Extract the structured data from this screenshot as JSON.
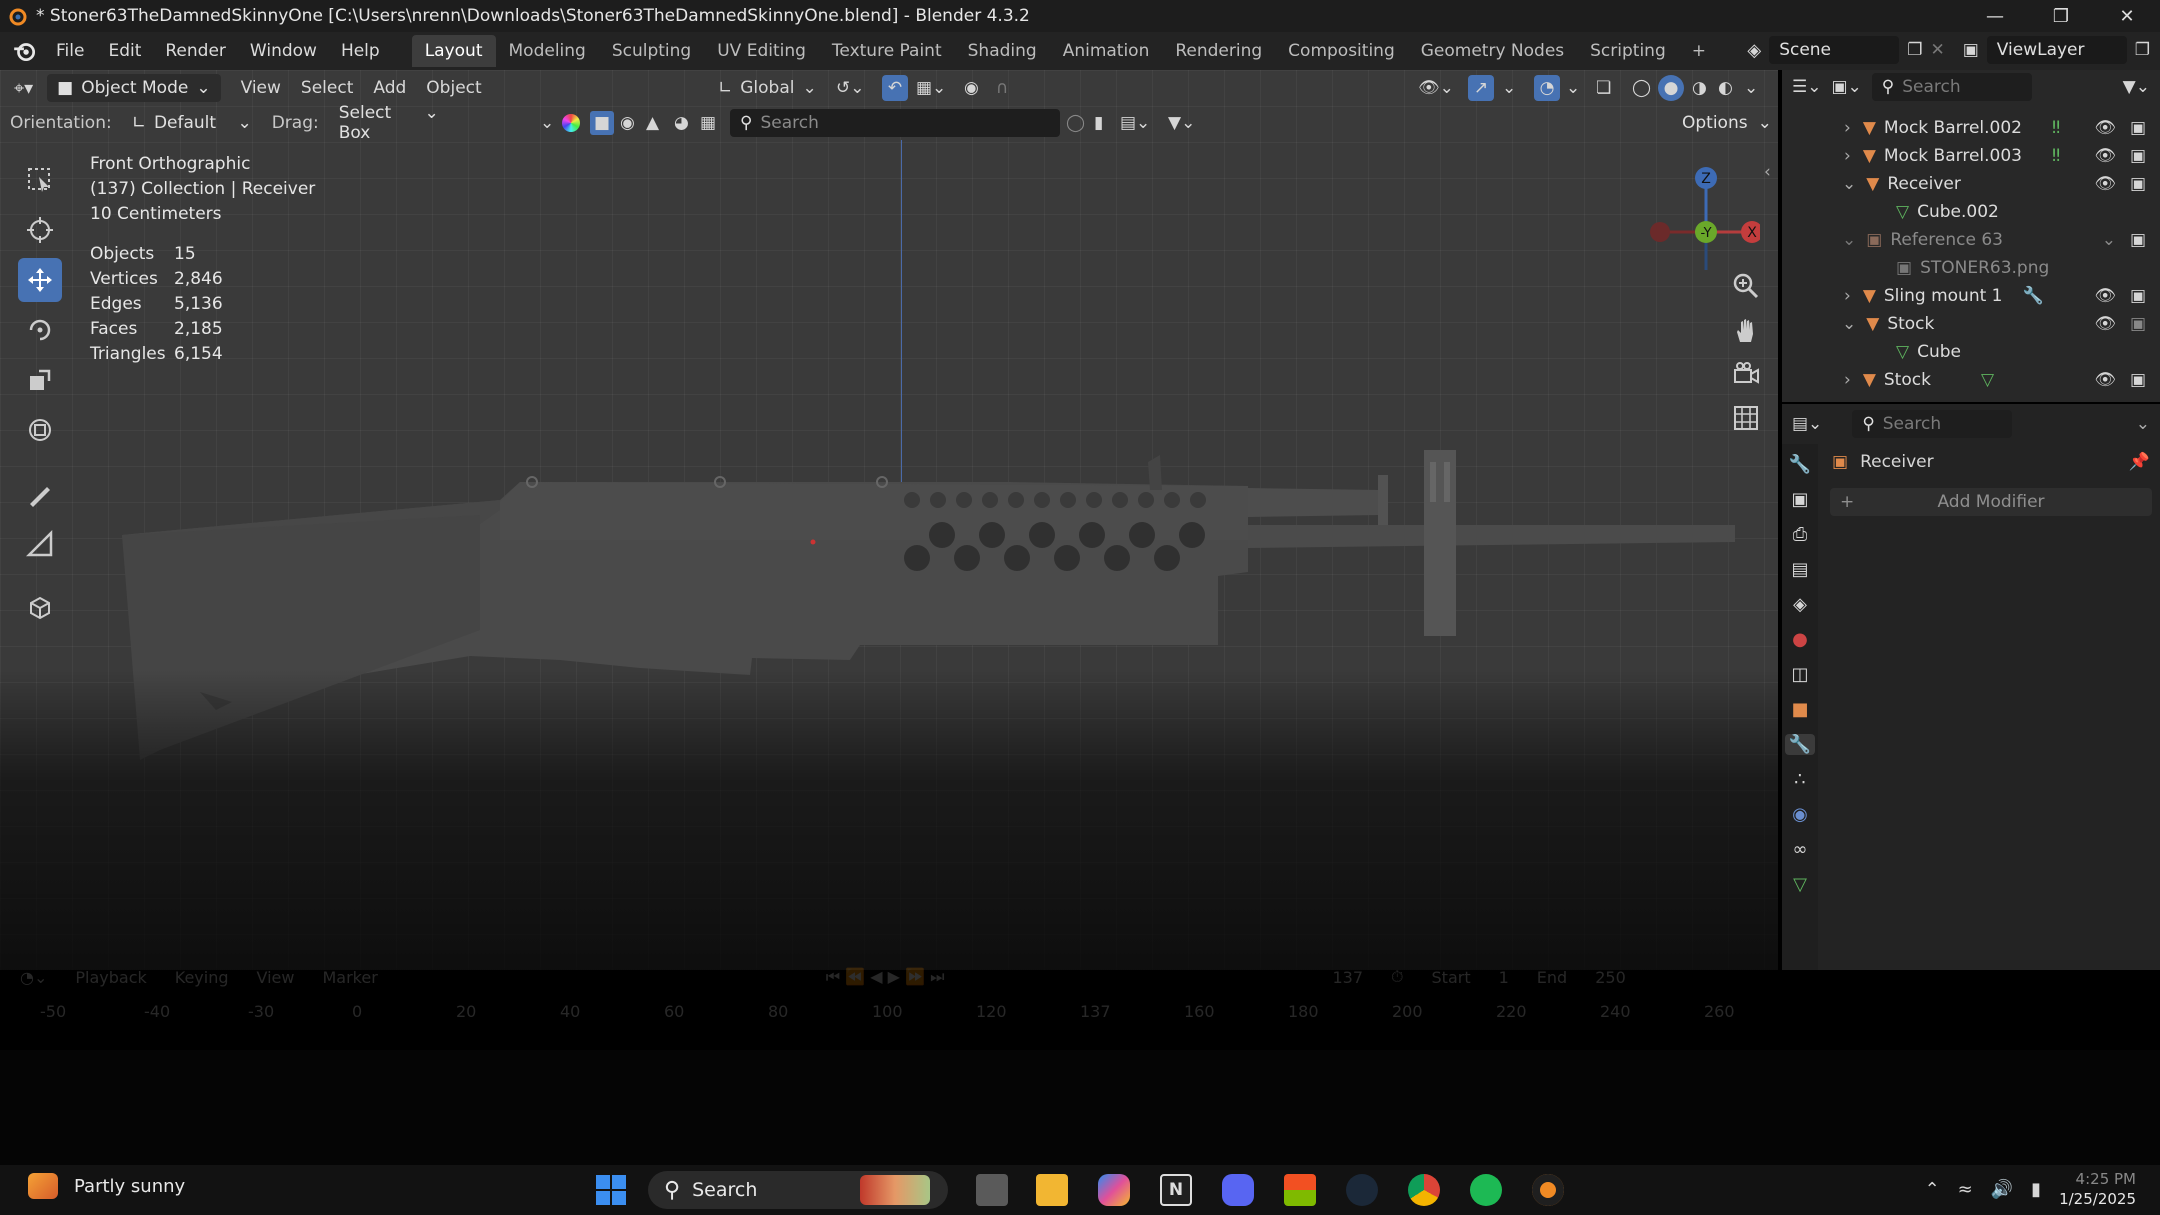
{
  "window": {
    "title": "* Stoner63TheDamnedSkinnyOne [C:\\Users\\nrenn\\Downloads\\Stoner63TheDamnedSkinnyOne.blend] - Blender 4.3.2"
  },
  "menu": {
    "items": [
      "File",
      "Edit",
      "Render",
      "Window",
      "Help"
    ]
  },
  "workspaces": {
    "tabs": [
      "Layout",
      "Modeling",
      "Sculpting",
      "UV Editing",
      "Texture Paint",
      "Shading",
      "Animation",
      "Rendering",
      "Compositing",
      "Geometry Nodes",
      "Scripting"
    ],
    "active": "Layout",
    "add": "+"
  },
  "scene": {
    "name": "Scene",
    "view_layer": "ViewLayer"
  },
  "viewport_header": {
    "mode": "Object Mode",
    "menus": [
      "View",
      "Select",
      "Add",
      "Object"
    ],
    "transform": "Global"
  },
  "tool_settings": {
    "orientation_label": "Orientation:",
    "orientation_value": "Default",
    "drag_label": "Drag:",
    "drag_value": "Select Box",
    "search_placeholder": "Search",
    "options": "Options"
  },
  "overlay": {
    "view_name": "Front Orthographic",
    "collection": "(137) Collection | Receiver",
    "scale": "10 Centimeters"
  },
  "stats": [
    {
      "label": "Objects",
      "value": "15"
    },
    {
      "label": "Vertices",
      "value": "2,846"
    },
    {
      "label": "Edges",
      "value": "5,136"
    },
    {
      "label": "Faces",
      "value": "2,185"
    },
    {
      "label": "Triangles",
      "value": "6,154"
    }
  ],
  "gizmo": {
    "z": "Z",
    "y": "-Y",
    "x": "X"
  },
  "outliner": {
    "search_placeholder": "Search",
    "rows": [
      {
        "label": "Mock Barrel.002",
        "indent": 0
      },
      {
        "label": "Mock Barrel.003",
        "indent": 0
      },
      {
        "label": "Receiver",
        "indent": 0
      },
      {
        "label": "Cube.002",
        "indent": 1
      },
      {
        "label": "Reference 63",
        "indent": 0
      },
      {
        "label": "STONER63.png",
        "indent": 1
      },
      {
        "label": "Sling mount 1",
        "indent": 0
      },
      {
        "label": "Stock",
        "indent": 0
      },
      {
        "label": "Cube",
        "indent": 1
      },
      {
        "label": "Stock",
        "indent": 0
      }
    ]
  },
  "properties": {
    "search_placeholder": "Search",
    "object_name": "Receiver",
    "add_modifier": "Add Modifier"
  },
  "timeline": {
    "menus": [
      "Playback",
      "Keying",
      "View",
      "Marker"
    ],
    "current_frame": "137",
    "start_label": "Start",
    "start": "1",
    "end_label": "End",
    "end": "250",
    "ticks": [
      "-50",
      "-40",
      "-30",
      "0",
      "20",
      "40",
      "60",
      "80",
      "100",
      "120",
      "137",
      "160",
      "180",
      "200",
      "220",
      "240",
      "260"
    ]
  },
  "taskbar": {
    "weather": "Partly sunny",
    "search": "Search",
    "date": "1/25/2025",
    "time": "4:25 PM"
  }
}
